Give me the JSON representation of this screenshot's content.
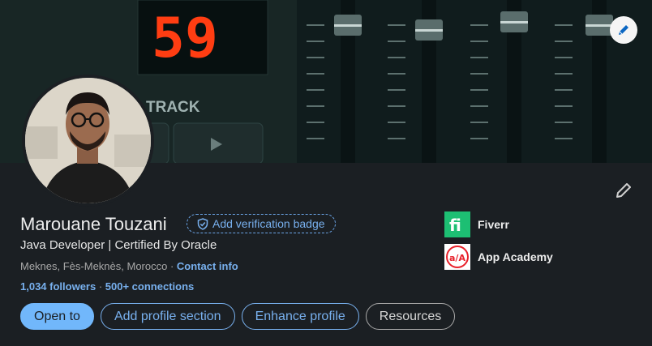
{
  "banner": {
    "display_number": "59",
    "track_label": "TRACK"
  },
  "profile": {
    "name": "Marouane Touzani",
    "verification_badge": "Add verification badge",
    "headline": "Java Developer | Certified By Oracle",
    "location": "Meknes, Fès-Meknès, Morocco",
    "separator": " · ",
    "contact_info": "Contact info",
    "followers": "1,034 followers",
    "stats_separator": " · ",
    "connections": "500+ connections"
  },
  "actions": {
    "open_to": "Open to",
    "add_profile_section": "Add profile section",
    "enhance_profile": "Enhance profile",
    "resources": "Resources"
  },
  "companies": [
    {
      "name": "Fiverr",
      "icon": "fiverr-logo",
      "color": "#1dbf73",
      "logo_text": "fi"
    },
    {
      "name": "App Academy",
      "icon": "app-academy-logo",
      "color": "#e8202a",
      "logo_text": "a/A"
    }
  ],
  "colors": {
    "accent": "#71b7fb",
    "link": "#78b0ee",
    "background": "#1b1f23"
  }
}
